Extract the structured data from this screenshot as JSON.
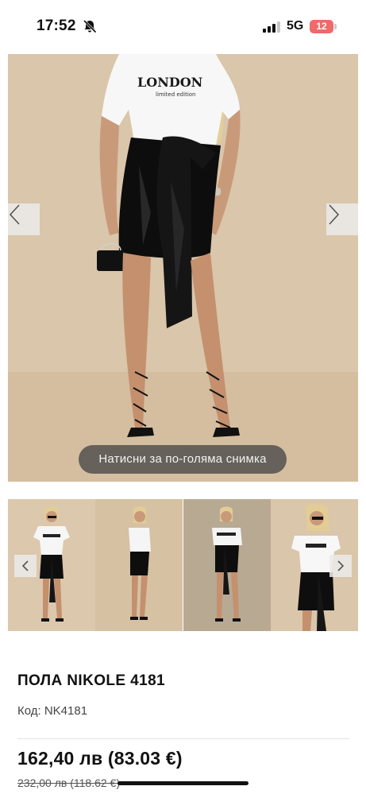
{
  "status_bar": {
    "time": "17:52",
    "network": "5G",
    "battery": "12",
    "mute_icon": "bell-slash-icon",
    "signal_icon": "cellular-signal-icon"
  },
  "gallery": {
    "zoom_hint": "Натисни за по-голяма снимка",
    "prev_icon": "chevron-left-icon",
    "next_icon": "chevron-right-icon",
    "shirt_text": "LONDON",
    "shirt_subtext": "limited edition"
  },
  "product": {
    "title": "ПОЛА NIKOLE 4181",
    "code": "Код: NK4181",
    "price": "162,40 лв  (83.03 €)",
    "old_price": "232,00 лв (118.62 €)"
  },
  "colors": {
    "image_background": "#d9c4a8",
    "battery_low": "#ef6a6a",
    "hint_overlay": "#464646"
  }
}
